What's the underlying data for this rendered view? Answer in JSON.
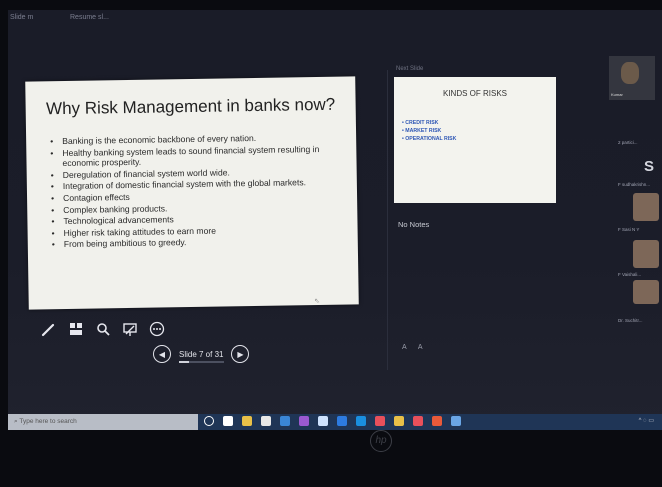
{
  "window": {
    "title_left": "Slide m",
    "title_mid": "Resume sl..."
  },
  "main_slide": {
    "title": "Why Risk Management in banks now?",
    "bullets": [
      "Banking is the economic backbone of every nation.",
      "Healthy banking system leads to sound financial system resulting in economic prosperity.",
      "Deregulation of financial system world wide.",
      "Integration of domestic financial system with the global markets.",
      "Contagion effects",
      "Complex banking products.",
      "Technological advancements",
      "Higher risk taking attitudes to earn more",
      "From being ambitious to greedy."
    ]
  },
  "next_slide": {
    "label": "Next Slide",
    "title": "KINDS OF RISKS",
    "items": [
      "CREDIT RISK",
      "MARKET RISK",
      "OPERATIONAL RISK"
    ]
  },
  "notes": {
    "label": "No Notes",
    "font_controls": "A A"
  },
  "nav": {
    "slide_counter": "Slide 7 of 31",
    "progress": 0.2258
  },
  "participants": {
    "big_letter": "S",
    "cam_name": "Kumar",
    "names": [
      "2 partici...",
      "F sudhakrishn...",
      "F Sasi N Y",
      "F Vaishali...",
      "Dr. Suchitr..."
    ]
  },
  "taskbar": {
    "search_placeholder": "Type here to search",
    "icon_colors": [
      "#ffffff",
      "#ffffff",
      "#e8c048",
      "#e8e8e8",
      "#3a86d6",
      "#9b59d0",
      "#cfe3ff",
      "#2d7be0",
      "#1a8fe0",
      "#e8505b",
      "#e8c048",
      "#e8505b",
      "#e85a3a",
      "#6aa6e6"
    ]
  },
  "colors": {
    "accent_blue": "#2f57b5",
    "slide_bg": "#f1f1ec"
  }
}
